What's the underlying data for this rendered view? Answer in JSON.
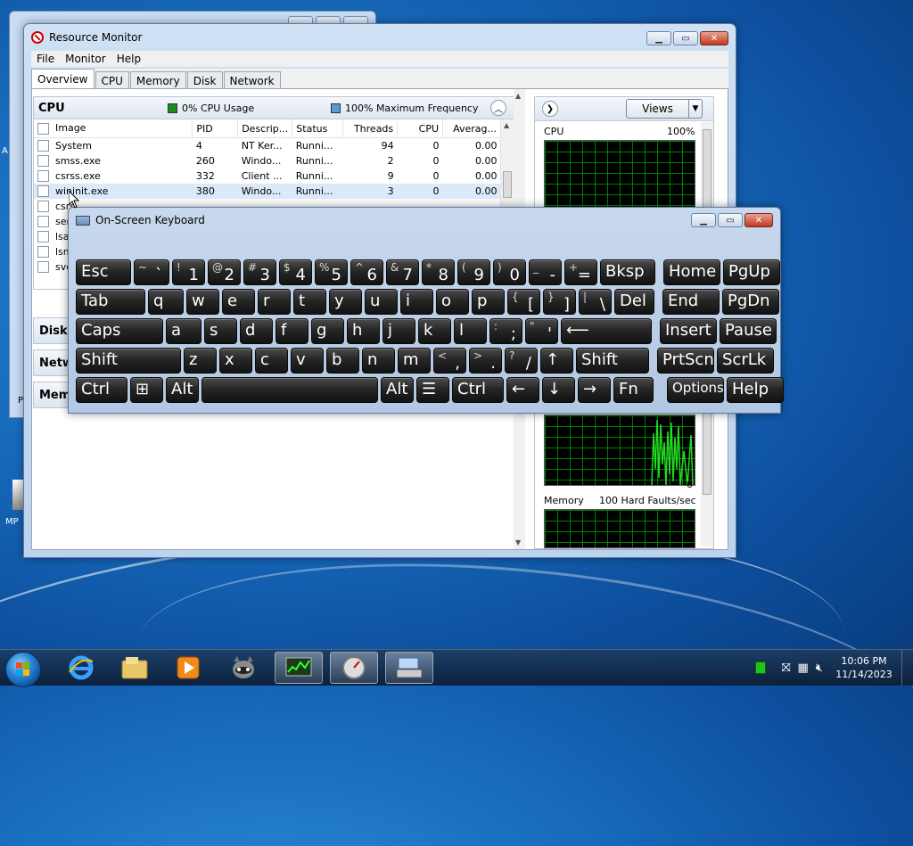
{
  "background_window": {
    "partial_labels": [
      "A",
      "P",
      "MP"
    ]
  },
  "resource_monitor": {
    "title": "Resource Monitor",
    "menu": [
      "File",
      "Monitor",
      "Help"
    ],
    "tabs": [
      "Overview",
      "CPU",
      "Memory",
      "Disk",
      "Network"
    ],
    "cpu": {
      "label": "CPU",
      "usage": "0% CPU Usage",
      "frequency": "100% Maximum Frequency",
      "usage_color": "#1e8a1e",
      "frequency_color": "#5b9bd5",
      "columns": [
        "Image",
        "PID",
        "Descrip...",
        "Status",
        "Threads",
        "CPU",
        "Averag..."
      ],
      "rows": [
        {
          "image": "System",
          "pid": "4",
          "desc": "NT Ker...",
          "status": "Runni...",
          "threads": "94",
          "cpu": "0",
          "avg": "0.00"
        },
        {
          "image": "smss.exe",
          "pid": "260",
          "desc": "Windo...",
          "status": "Runni...",
          "threads": "2",
          "cpu": "0",
          "avg": "0.00"
        },
        {
          "image": "csrss.exe",
          "pid": "332",
          "desc": "Client ...",
          "status": "Runni...",
          "threads": "9",
          "cpu": "0",
          "avg": "0.00"
        },
        {
          "image": "wininit.exe",
          "pid": "380",
          "desc": "Windo...",
          "status": "Runni...",
          "threads": "3",
          "cpu": "0",
          "avg": "0.00"
        },
        {
          "image": "csrs",
          "pid": "",
          "desc": "",
          "status": "",
          "threads": "",
          "cpu": "",
          "avg": ""
        },
        {
          "image": "serv",
          "pid": "",
          "desc": "",
          "status": "",
          "threads": "",
          "cpu": "",
          "avg": ""
        },
        {
          "image": "lsas",
          "pid": "",
          "desc": "",
          "status": "",
          "threads": "",
          "cpu": "",
          "avg": ""
        },
        {
          "image": "lsm",
          "pid": "",
          "desc": "",
          "status": "",
          "threads": "",
          "cpu": "",
          "avg": ""
        },
        {
          "image": "svch",
          "pid": "",
          "desc": "",
          "status": "",
          "threads": "",
          "cpu": "",
          "avg": ""
        }
      ]
    },
    "sections": [
      "Disk",
      "Netwo",
      "Memo"
    ],
    "right": {
      "views_label": "Views",
      "cpu_graph_label": "CPU",
      "cpu_graph_max": "100%",
      "graph_zero": "0",
      "memory_graph_label": "Memory",
      "memory_graph_rate": "100 Hard Faults/sec"
    }
  },
  "osk": {
    "title": "On-Screen Keyboard",
    "rows": [
      [
        {
          "m": "Esc"
        },
        {
          "s": "~",
          "m": "`"
        },
        {
          "s": "!",
          "m": "1"
        },
        {
          "s": "@",
          "m": "2"
        },
        {
          "s": "#",
          "m": "3"
        },
        {
          "s": "$",
          "m": "4"
        },
        {
          "s": "%",
          "m": "5"
        },
        {
          "s": "^",
          "m": "6"
        },
        {
          "s": "&",
          "m": "7"
        },
        {
          "s": "*",
          "m": "8"
        },
        {
          "s": "(",
          "m": "9"
        },
        {
          "s": ")",
          "m": "0"
        },
        {
          "s": "_",
          "m": "-"
        },
        {
          "s": "+",
          "m": "="
        },
        {
          "m": "Bksp"
        },
        {
          "m": "Home"
        },
        {
          "m": "PgUp"
        }
      ],
      [
        {
          "m": "Tab"
        },
        {
          "m": "q"
        },
        {
          "m": "w"
        },
        {
          "m": "e"
        },
        {
          "m": "r"
        },
        {
          "m": "t"
        },
        {
          "m": "y"
        },
        {
          "m": "u"
        },
        {
          "m": "i"
        },
        {
          "m": "o"
        },
        {
          "m": "p"
        },
        {
          "s": "{",
          "m": "["
        },
        {
          "s": "}",
          "m": "]"
        },
        {
          "s": "|",
          "m": "\\"
        },
        {
          "m": "Del"
        },
        {
          "m": "End"
        },
        {
          "m": "PgDn"
        }
      ],
      [
        {
          "m": "Caps"
        },
        {
          "m": "a"
        },
        {
          "m": "s"
        },
        {
          "m": "d"
        },
        {
          "m": "f"
        },
        {
          "m": "g"
        },
        {
          "m": "h"
        },
        {
          "m": "j"
        },
        {
          "m": "k"
        },
        {
          "m": "l"
        },
        {
          "s": ":",
          "m": ";"
        },
        {
          "s": "\"",
          "m": "'"
        },
        {
          "m": "⟵"
        },
        {
          "m": "Insert"
        },
        {
          "m": "Pause"
        }
      ],
      [
        {
          "m": "Shift"
        },
        {
          "m": "z"
        },
        {
          "m": "x"
        },
        {
          "m": "c"
        },
        {
          "m": "v"
        },
        {
          "m": "b"
        },
        {
          "m": "n"
        },
        {
          "m": "m"
        },
        {
          "s": "<",
          "m": ","
        },
        {
          "s": ">",
          "m": "."
        },
        {
          "s": "?",
          "m": "/"
        },
        {
          "m": "↑"
        },
        {
          "m": "Shift"
        },
        {
          "m": "PrtScn"
        },
        {
          "m": "ScrLk"
        }
      ],
      [
        {
          "m": "Ctrl"
        },
        {
          "m": "⊞"
        },
        {
          "m": "Alt"
        },
        {
          "m": ""
        },
        {
          "m": "Alt"
        },
        {
          "m": "☰"
        },
        {
          "m": "Ctrl"
        },
        {
          "m": "←"
        },
        {
          "m": "↓"
        },
        {
          "m": "→"
        },
        {
          "m": "Fn"
        },
        {
          "m": "Options"
        },
        {
          "m": "Help"
        }
      ]
    ]
  },
  "taskbar": {
    "time": "10:06 PM",
    "date": "11/14/2023",
    "items": [
      "internet-explorer-icon",
      "explorer-icon",
      "media-player-icon",
      "raccoon-app-icon",
      "resource-monitor-icon",
      "performance-icon",
      "on-screen-keyboard-icon"
    ]
  }
}
